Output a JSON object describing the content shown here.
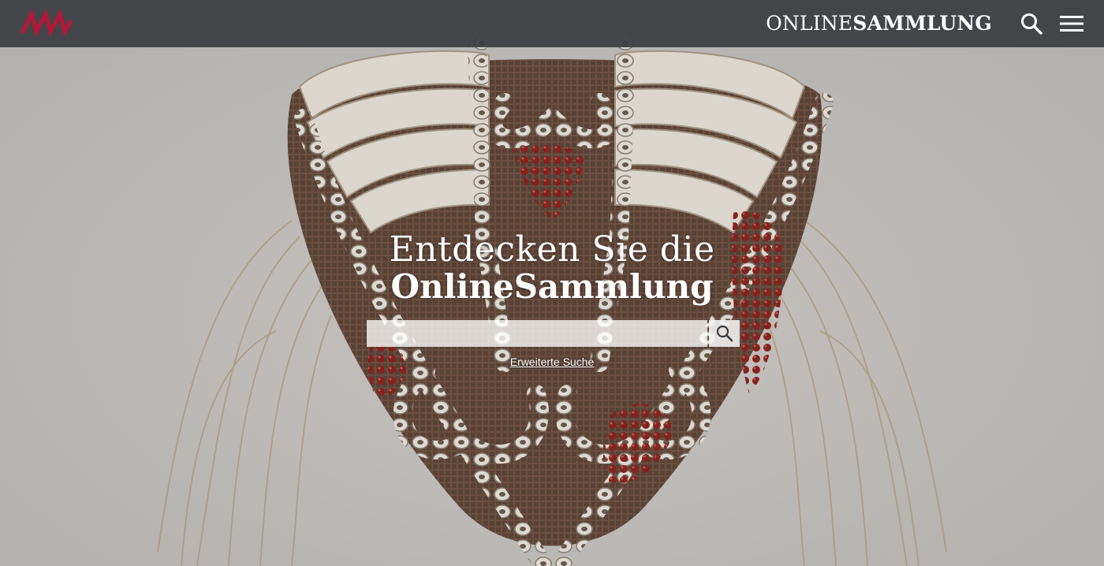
{
  "header": {
    "brand_thin": "ONLINE",
    "brand_bold": "SAMMLUNG",
    "logo_icon": "museum-logo-icon",
    "search_icon": "search-icon",
    "menu_icon": "hamburger-menu-icon"
  },
  "hero": {
    "title_line1": "Entdecken Sie die",
    "title_line2": "OnlineSammlung",
    "background_image": "shell-beaded-artifact-photo"
  },
  "search": {
    "placeholder": "",
    "value": "",
    "submit_icon": "search-icon",
    "advanced_link": "Erweiterte Suche"
  },
  "colors": {
    "header_bg": "#3a3c40",
    "logo_accent": "#b0183a",
    "text": "#ffffff",
    "hero_bg": "#c9c6c3"
  }
}
